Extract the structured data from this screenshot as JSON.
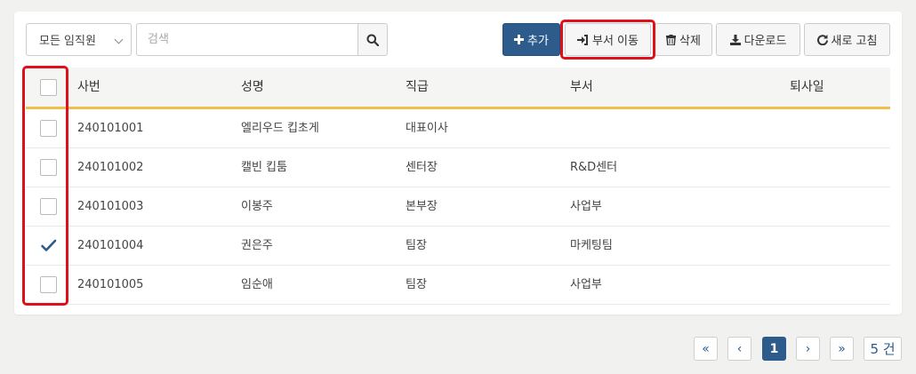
{
  "toolbar": {
    "employee_filter": "모든 임직원",
    "search_placeholder": "검색",
    "add_label": "추가",
    "move_label": "부서 이동",
    "delete_label": "삭제",
    "download_label": "다운로드",
    "refresh_label": "새로 고침",
    "icons": {
      "search": "search-icon",
      "add": "plus-icon",
      "move": "sign-in-icon",
      "delete": "trash-icon",
      "download": "download-icon",
      "refresh": "refresh-icon"
    }
  },
  "table": {
    "columns": [
      "사번",
      "성명",
      "직급",
      "부서",
      "퇴사일"
    ],
    "rows": [
      {
        "id": "240101001",
        "name": "엘리우드 킵초게",
        "rank": "대표이사",
        "dept": "",
        "resigned": "",
        "checked": false
      },
      {
        "id": "240101002",
        "name": "캘빈 킵툼",
        "rank": "센터장",
        "dept": "R&D센터",
        "resigned": "",
        "checked": false
      },
      {
        "id": "240101003",
        "name": "이봉주",
        "rank": "본부장",
        "dept": "사업부",
        "resigned": "",
        "checked": false
      },
      {
        "id": "240101004",
        "name": "권은주",
        "rank": "팀장",
        "dept": "마케팅팀",
        "resigned": "",
        "checked": true
      },
      {
        "id": "240101005",
        "name": "임순애",
        "rank": "팀장",
        "dept": "사업부",
        "resigned": "",
        "checked": false
      }
    ]
  },
  "pagination": {
    "first": "«",
    "prev": "‹",
    "current_page": "1",
    "next": "›",
    "last": "»",
    "total": "5 건"
  },
  "colors": {
    "primary": "#2c5b8c",
    "highlight": "#e0101a",
    "header_underline": "#f0c04c"
  }
}
